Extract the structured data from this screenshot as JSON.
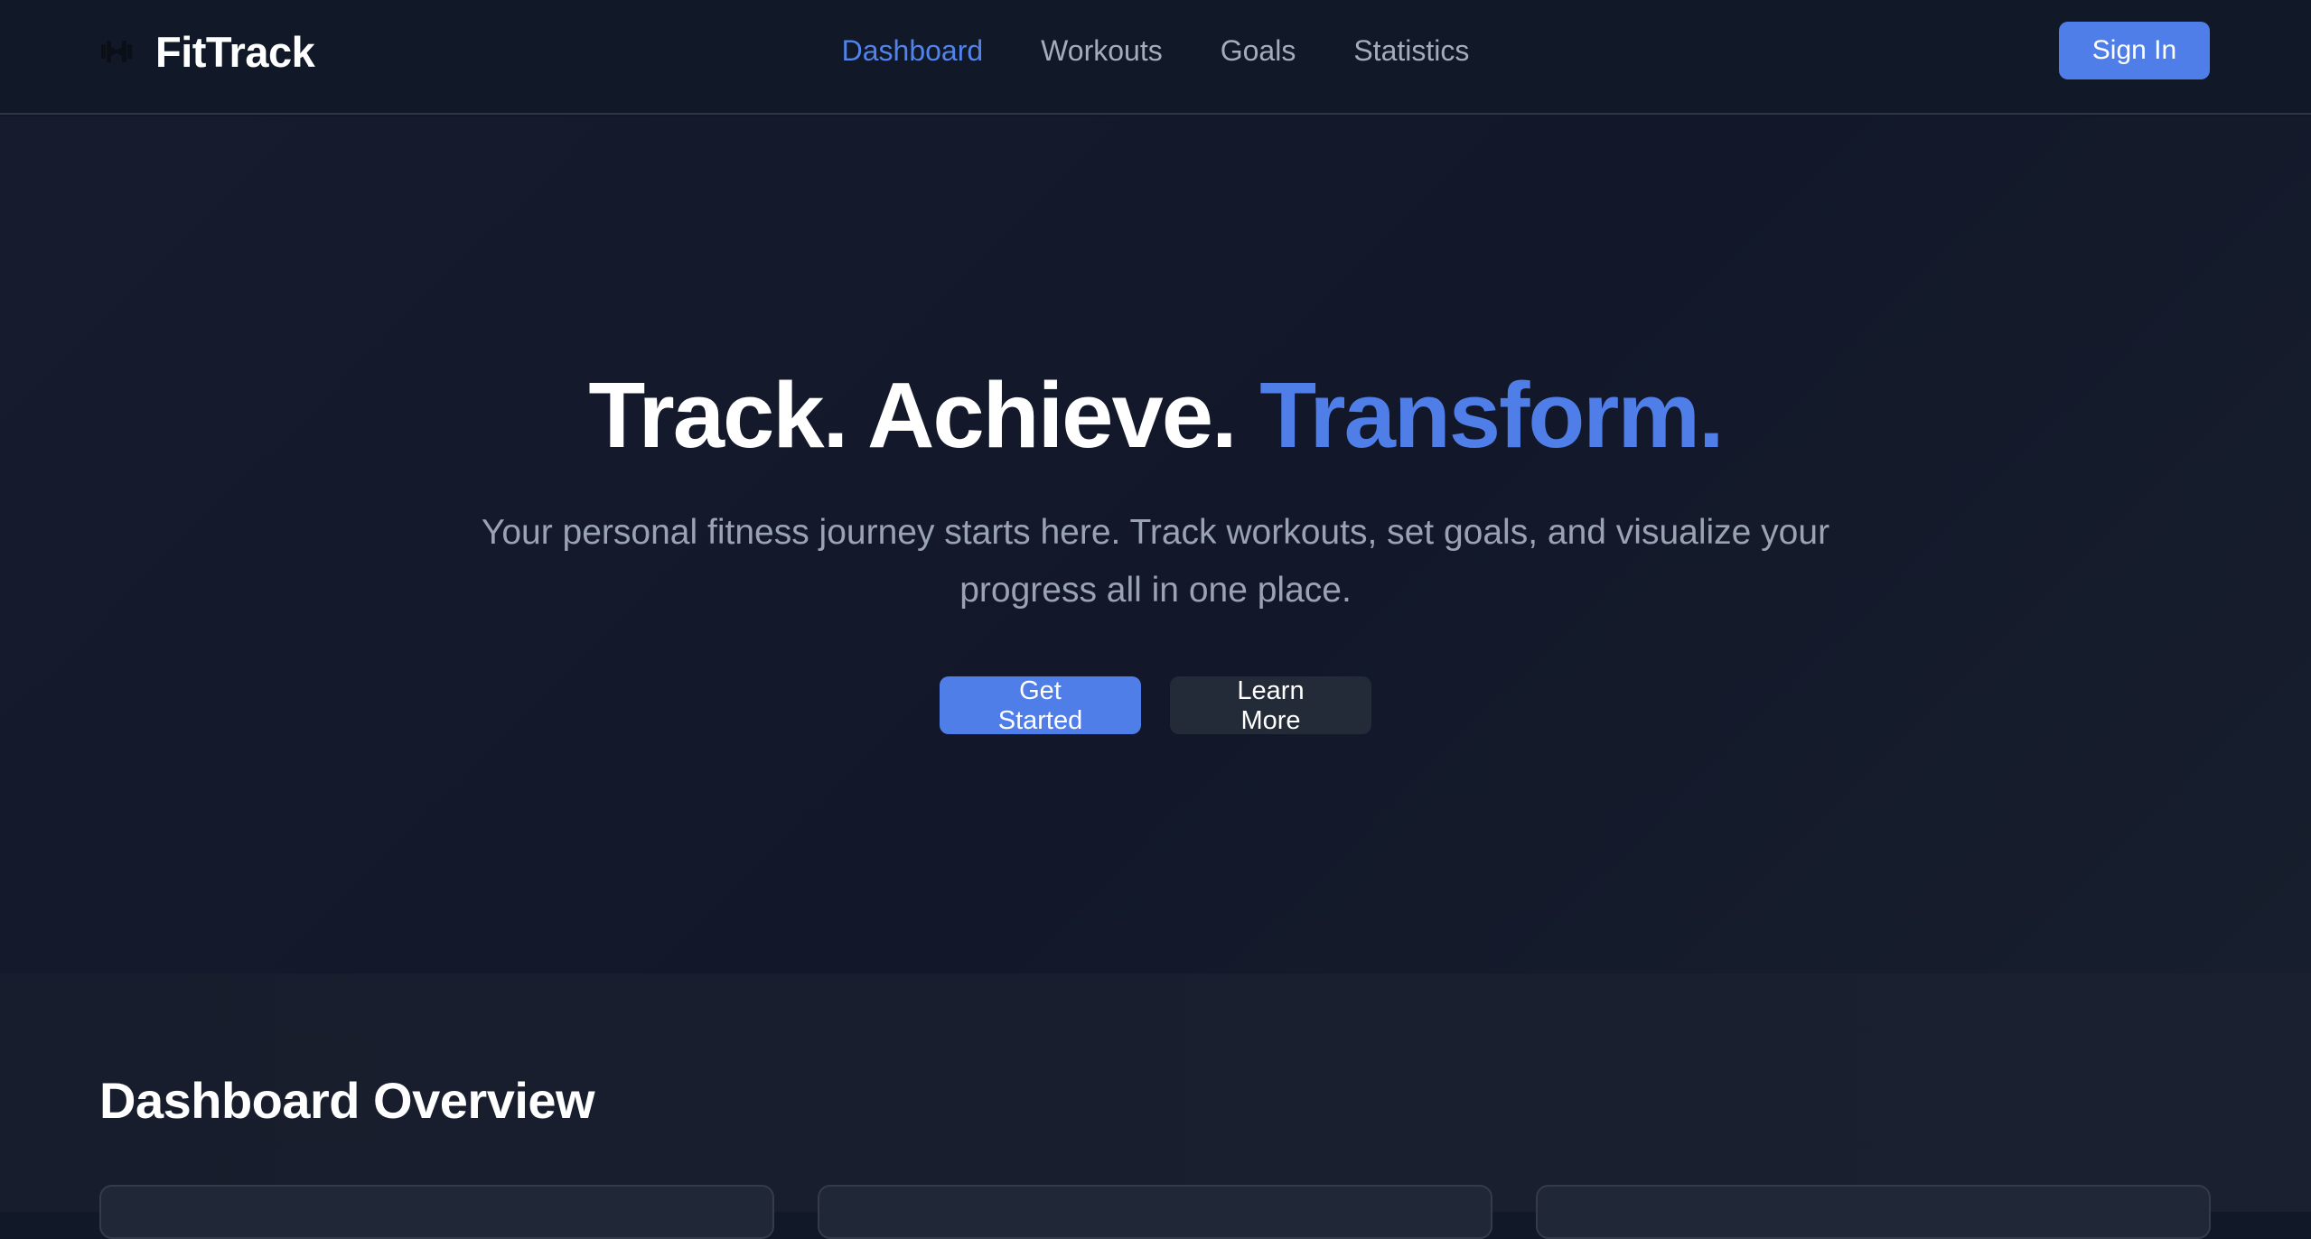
{
  "app": {
    "name": "FitTrack",
    "icon": "barbell-icon"
  },
  "nav": {
    "links": [
      {
        "label": "Dashboard",
        "active": true
      },
      {
        "label": "Workouts",
        "active": false
      },
      {
        "label": "Goals",
        "active": false
      },
      {
        "label": "Statistics",
        "active": false
      }
    ],
    "signin_label": "Sign In"
  },
  "hero": {
    "title_part1": "Track. Achieve. ",
    "title_accent": "Transform.",
    "subtitle": "Your personal fitness journey starts here. Track workouts, set goals, and visualize your progress all in one place.",
    "primary_button": "Get Started",
    "secondary_button": "Learn More"
  },
  "overview": {
    "title": "Dashboard Overview",
    "card_count": 3
  },
  "colors": {
    "accent": "#4f7ee8",
    "background": "#111827",
    "muted_text": "#9aa3b2"
  }
}
